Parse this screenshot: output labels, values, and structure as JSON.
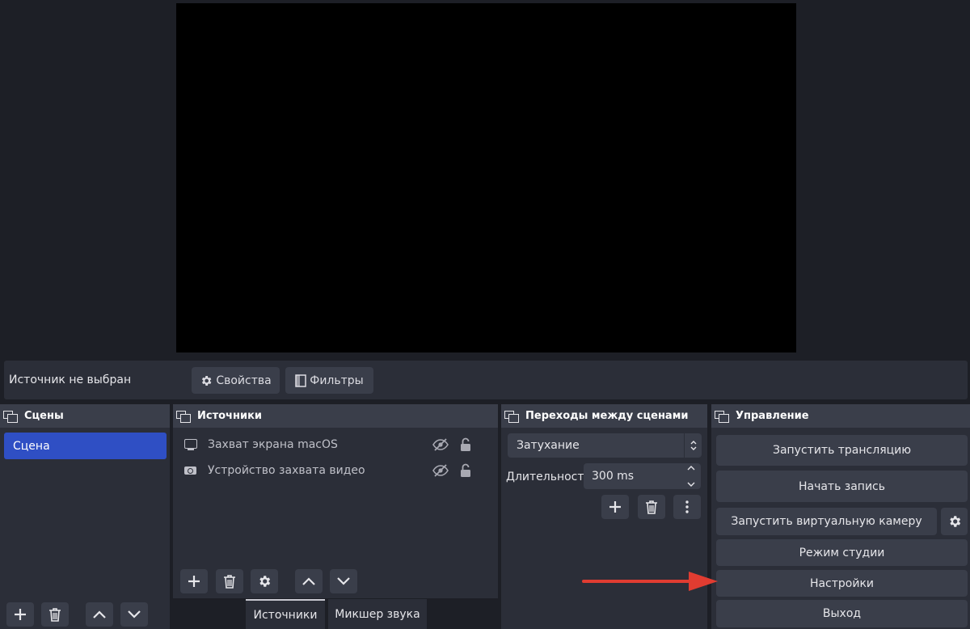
{
  "context_bar": {
    "no_source": "Источник не выбран",
    "properties_label": "Свойства",
    "filters_label": "Фильтры"
  },
  "scenes": {
    "title": "Сцены",
    "items": [
      "Сцена"
    ]
  },
  "sources": {
    "title": "Источники",
    "items": [
      {
        "label": "Захват экрана macOS",
        "icon": "monitor-icon"
      },
      {
        "label": "Устройство захвата видео",
        "icon": "camera-icon"
      }
    ]
  },
  "transitions": {
    "title": "Переходы между сценами",
    "selected": "Затухание",
    "duration_label": "Длительность",
    "duration_value": "300 ms"
  },
  "controls": {
    "title": "Управление",
    "start_stream": "Запустить трансляцию",
    "start_record": "Начать запись",
    "virtual_cam": "Запустить виртуальную камеру",
    "studio_mode": "Режим студии",
    "settings": "Настройки",
    "exit": "Выход"
  },
  "bottom_tabs": [
    "Источники",
    "Микшер звука"
  ],
  "colors": {
    "background": "#1d1f26",
    "dock": "#2b2e38",
    "button": "#3a3e4a",
    "selected_scene": "#2f4fc4",
    "annotation_arrow": "#e03c31"
  }
}
